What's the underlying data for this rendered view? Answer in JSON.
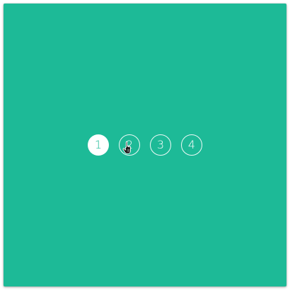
{
  "theme": {
    "panel_color": "#1dba97",
    "active_dot_text_color": "#1dba97"
  },
  "pagination": {
    "active_index": 0,
    "items": [
      {
        "label": "1"
      },
      {
        "label": "2"
      },
      {
        "label": "3"
      },
      {
        "label": "4"
      }
    ]
  },
  "cursor": {
    "type": "hand-pointer-icon"
  }
}
